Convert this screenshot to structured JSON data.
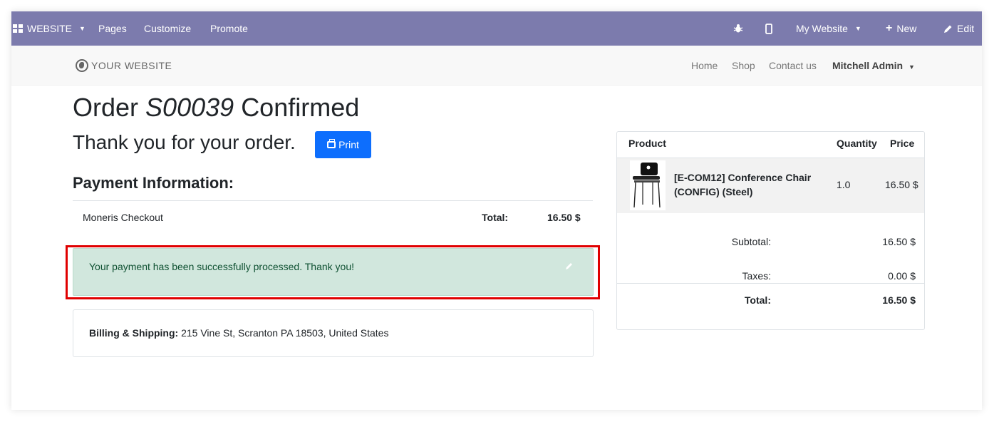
{
  "adminbar": {
    "website_label": "WEBSITE",
    "pages": "Pages",
    "customize": "Customize",
    "promote": "Promote",
    "site_selector": "My Website",
    "new_label": "New",
    "edit_label": "Edit"
  },
  "header": {
    "logo_text": "YOUR WEBSITE",
    "nav": [
      "Home",
      "Shop",
      "Contact us"
    ],
    "user": "Mitchell Admin"
  },
  "main": {
    "title_prefix": "Order",
    "order_number": "S00039",
    "title_suffix": "Confirmed",
    "thank_you": "Thank you for your order.",
    "print_label": "Print",
    "payment_heading": "Payment Information:",
    "payment_method": "Moneris Checkout",
    "total_label": "Total:",
    "total_value": "16.50 $",
    "alert_message": "Your payment has been successfully processed. Thank you!",
    "billing_label": "Billing & Shipping:",
    "billing_address": "215 Vine St, Scranton PA 18503, United States"
  },
  "summary": {
    "headers": {
      "product": "Product",
      "quantity": "Quantity",
      "price": "Price"
    },
    "item": {
      "name": "[E-COM12] Conference Chair (CONFIG) (Steel)",
      "quantity": "1.0",
      "price": "16.50 $"
    },
    "subtotal_label": "Subtotal:",
    "subtotal_value": "16.50 $",
    "taxes_label": "Taxes:",
    "taxes_value": "0.00 $",
    "total_label": "Total:",
    "total_value": "16.50 $"
  },
  "colors": {
    "adminbar": "#7c7bad",
    "primary": "#0d6efd",
    "success_bg": "#d1e7dd",
    "success_text": "#0f5132",
    "highlight": "#e00000"
  }
}
